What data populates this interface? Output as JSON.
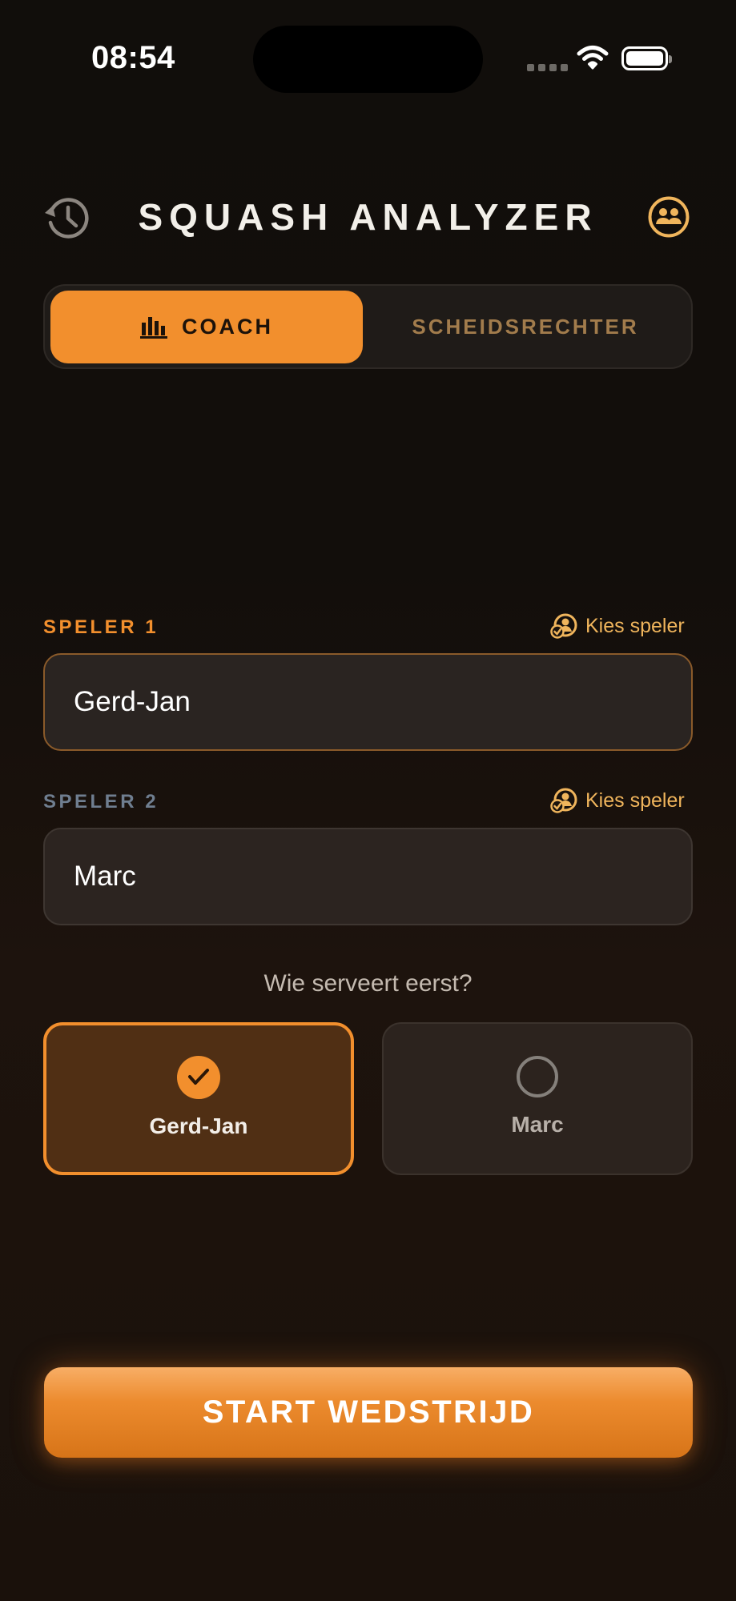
{
  "status_bar": {
    "time": "08:54"
  },
  "header": {
    "title": "SQUASH ANALYZER",
    "left_icon": "history-icon",
    "right_icon": "players-icon"
  },
  "mode_toggle": {
    "options": [
      {
        "label": "COACH",
        "icon": "bar-chart-icon",
        "selected": true
      },
      {
        "label": "SCHEIDSRECHTER",
        "selected": false
      }
    ]
  },
  "player1": {
    "label": "SPELER 1",
    "choose_label": "Kies speler",
    "value": "Gerd-Jan"
  },
  "player2": {
    "label": "SPELER 2",
    "choose_label": "Kies speler",
    "value": "Marc"
  },
  "serve": {
    "question": "Wie serveert eerst?",
    "options": [
      {
        "name": "Gerd-Jan",
        "selected": true
      },
      {
        "name": "Marc",
        "selected": false
      }
    ]
  },
  "start_button": {
    "label": "START WEDSTRIJD"
  },
  "colors": {
    "accent": "#f28f2d",
    "gold": "#f0b55c",
    "muted_blue": "#6f7e90",
    "background": "#110e0b"
  }
}
